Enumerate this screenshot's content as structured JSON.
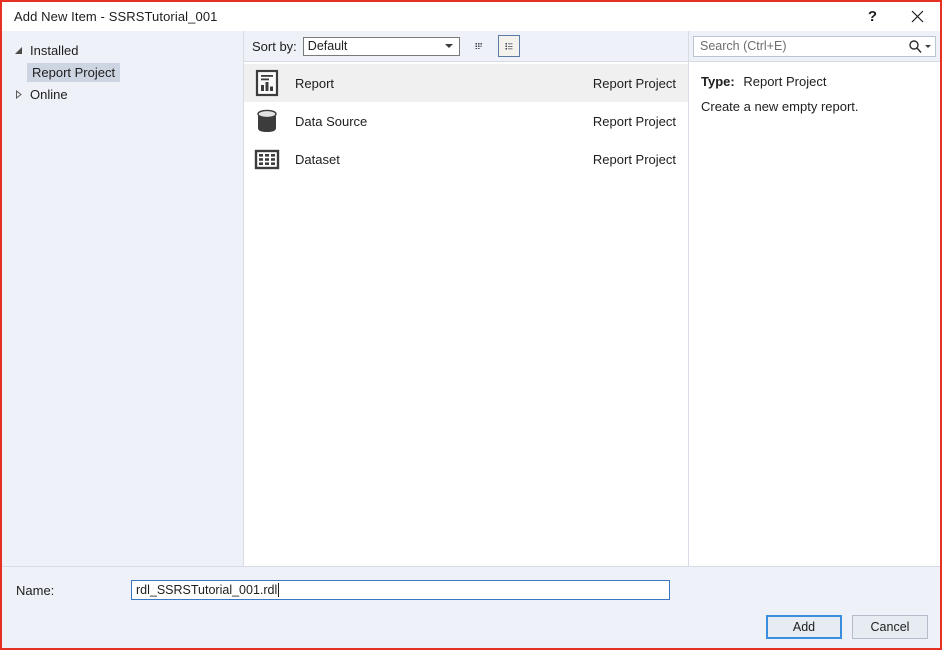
{
  "window": {
    "title": "Add New Item - SSRSTutorial_001",
    "help_button": "?",
    "close_button": "✕",
    "border_color": "#e63122"
  },
  "sidebar": {
    "items": [
      {
        "label": "Installed",
        "level": 0,
        "expanded": true,
        "selected": false,
        "twisty": "triangle-down-filled"
      },
      {
        "label": "Report Project",
        "level": 1,
        "expanded": false,
        "selected": true,
        "twisty": "none"
      },
      {
        "label": "Online",
        "level": 0,
        "expanded": false,
        "selected": false,
        "twisty": "triangle-right-outline"
      }
    ]
  },
  "toolbar": {
    "sort_by_label": "Sort by:",
    "sort_by_value": "Default",
    "view_small_icons": "small-icons-view",
    "view_list": "list-view",
    "active_view": "list-view"
  },
  "search": {
    "placeholder": "Search (Ctrl+E)",
    "value": "",
    "icon": "search-icon"
  },
  "item_list": {
    "column_origin_header": "",
    "items": [
      {
        "name": "Report",
        "origin": "Report Project",
        "icon": "report-document-chart-icon",
        "selected": true
      },
      {
        "name": "Data Source",
        "origin": "Report Project",
        "icon": "database-cylinder-icon",
        "selected": false
      },
      {
        "name": "Dataset",
        "origin": "Report Project",
        "icon": "dataset-grid-icon",
        "selected": false
      }
    ]
  },
  "details": {
    "type_label": "Type:",
    "type_value": "Report Project",
    "description": "Create a new empty report."
  },
  "bottom": {
    "name_label": "Name:",
    "name_value": "rdl_SSRSTutorial_001.rdl",
    "add_button": "Add",
    "cancel_button": "Cancel"
  },
  "colors": {
    "accent_border": "#e63122",
    "panel_background": "#eef1f7",
    "selection_tree": "#cdd4e2",
    "selection_list": "#f0f0f0",
    "default_button_border": "#3b8ede"
  }
}
